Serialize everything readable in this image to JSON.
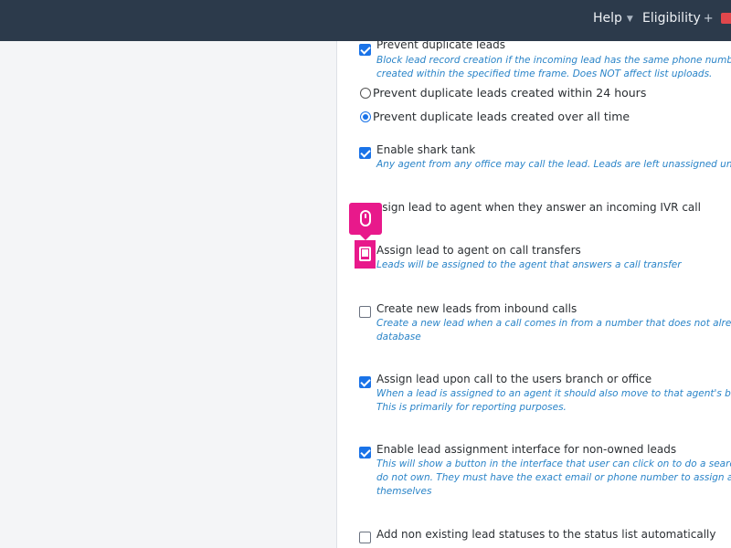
{
  "topbar": {
    "help_label": "Help",
    "eligibility_label": "Eligibility",
    "caret_icon": "chevron-down-icon",
    "plus_icon": "plus-icon",
    "accent_badge_color": "#e0474c"
  },
  "settings": {
    "prevent_duplicate": {
      "label": "Prevent duplicate leads",
      "checked": true,
      "help": [
        "Block lead record creation if the incoming lead has the same phone number as a le",
        "created within the specified time frame. Does NOT affect list uploads."
      ]
    },
    "dup_radio_24h": {
      "label": "Prevent duplicate leads created within 24 hours",
      "selected": false
    },
    "dup_radio_all": {
      "label": "Prevent duplicate leads created over all time",
      "selected": true
    },
    "shark_tank": {
      "label": "Enable shark tank",
      "checked": true,
      "help": [
        "Any agent from any office may call the lead. Leads are left unassigned until called."
      ]
    },
    "ivr_assign": {
      "label": "ssign lead to agent when they answer an incoming IVR call"
    },
    "call_transfer": {
      "label": "Assign lead to agent on call transfers",
      "help": [
        "Leads will be assigned to the agent that answers a call transfer"
      ]
    },
    "inbound_create": {
      "label": "Create new leads from inbound calls",
      "checked": false,
      "help": [
        "Create a new lead when a call comes in from a number that does not already exist",
        "database"
      ]
    },
    "branch_assign": {
      "label": "Assign lead upon call to the users branch or office",
      "checked": true,
      "help": [
        "When a lead is assigned to an agent it should also move to that agent's branch or o",
        "This is primarily for reporting purposes."
      ]
    },
    "non_owned": {
      "label": "Enable lead assignment interface for non-owned leads",
      "checked": true,
      "help": [
        "This will show a button in the interface that user can click on to do a search for lea",
        "do not own. They must have the exact email or phone number to assign a lead to",
        "themselves"
      ]
    },
    "status_list": {
      "label": "Add non existing lead statuses to the status list automatically",
      "checked": false
    }
  },
  "overlay": {
    "tooltip_icon": "mouse-icon",
    "highlight_color": "#e8198b"
  }
}
